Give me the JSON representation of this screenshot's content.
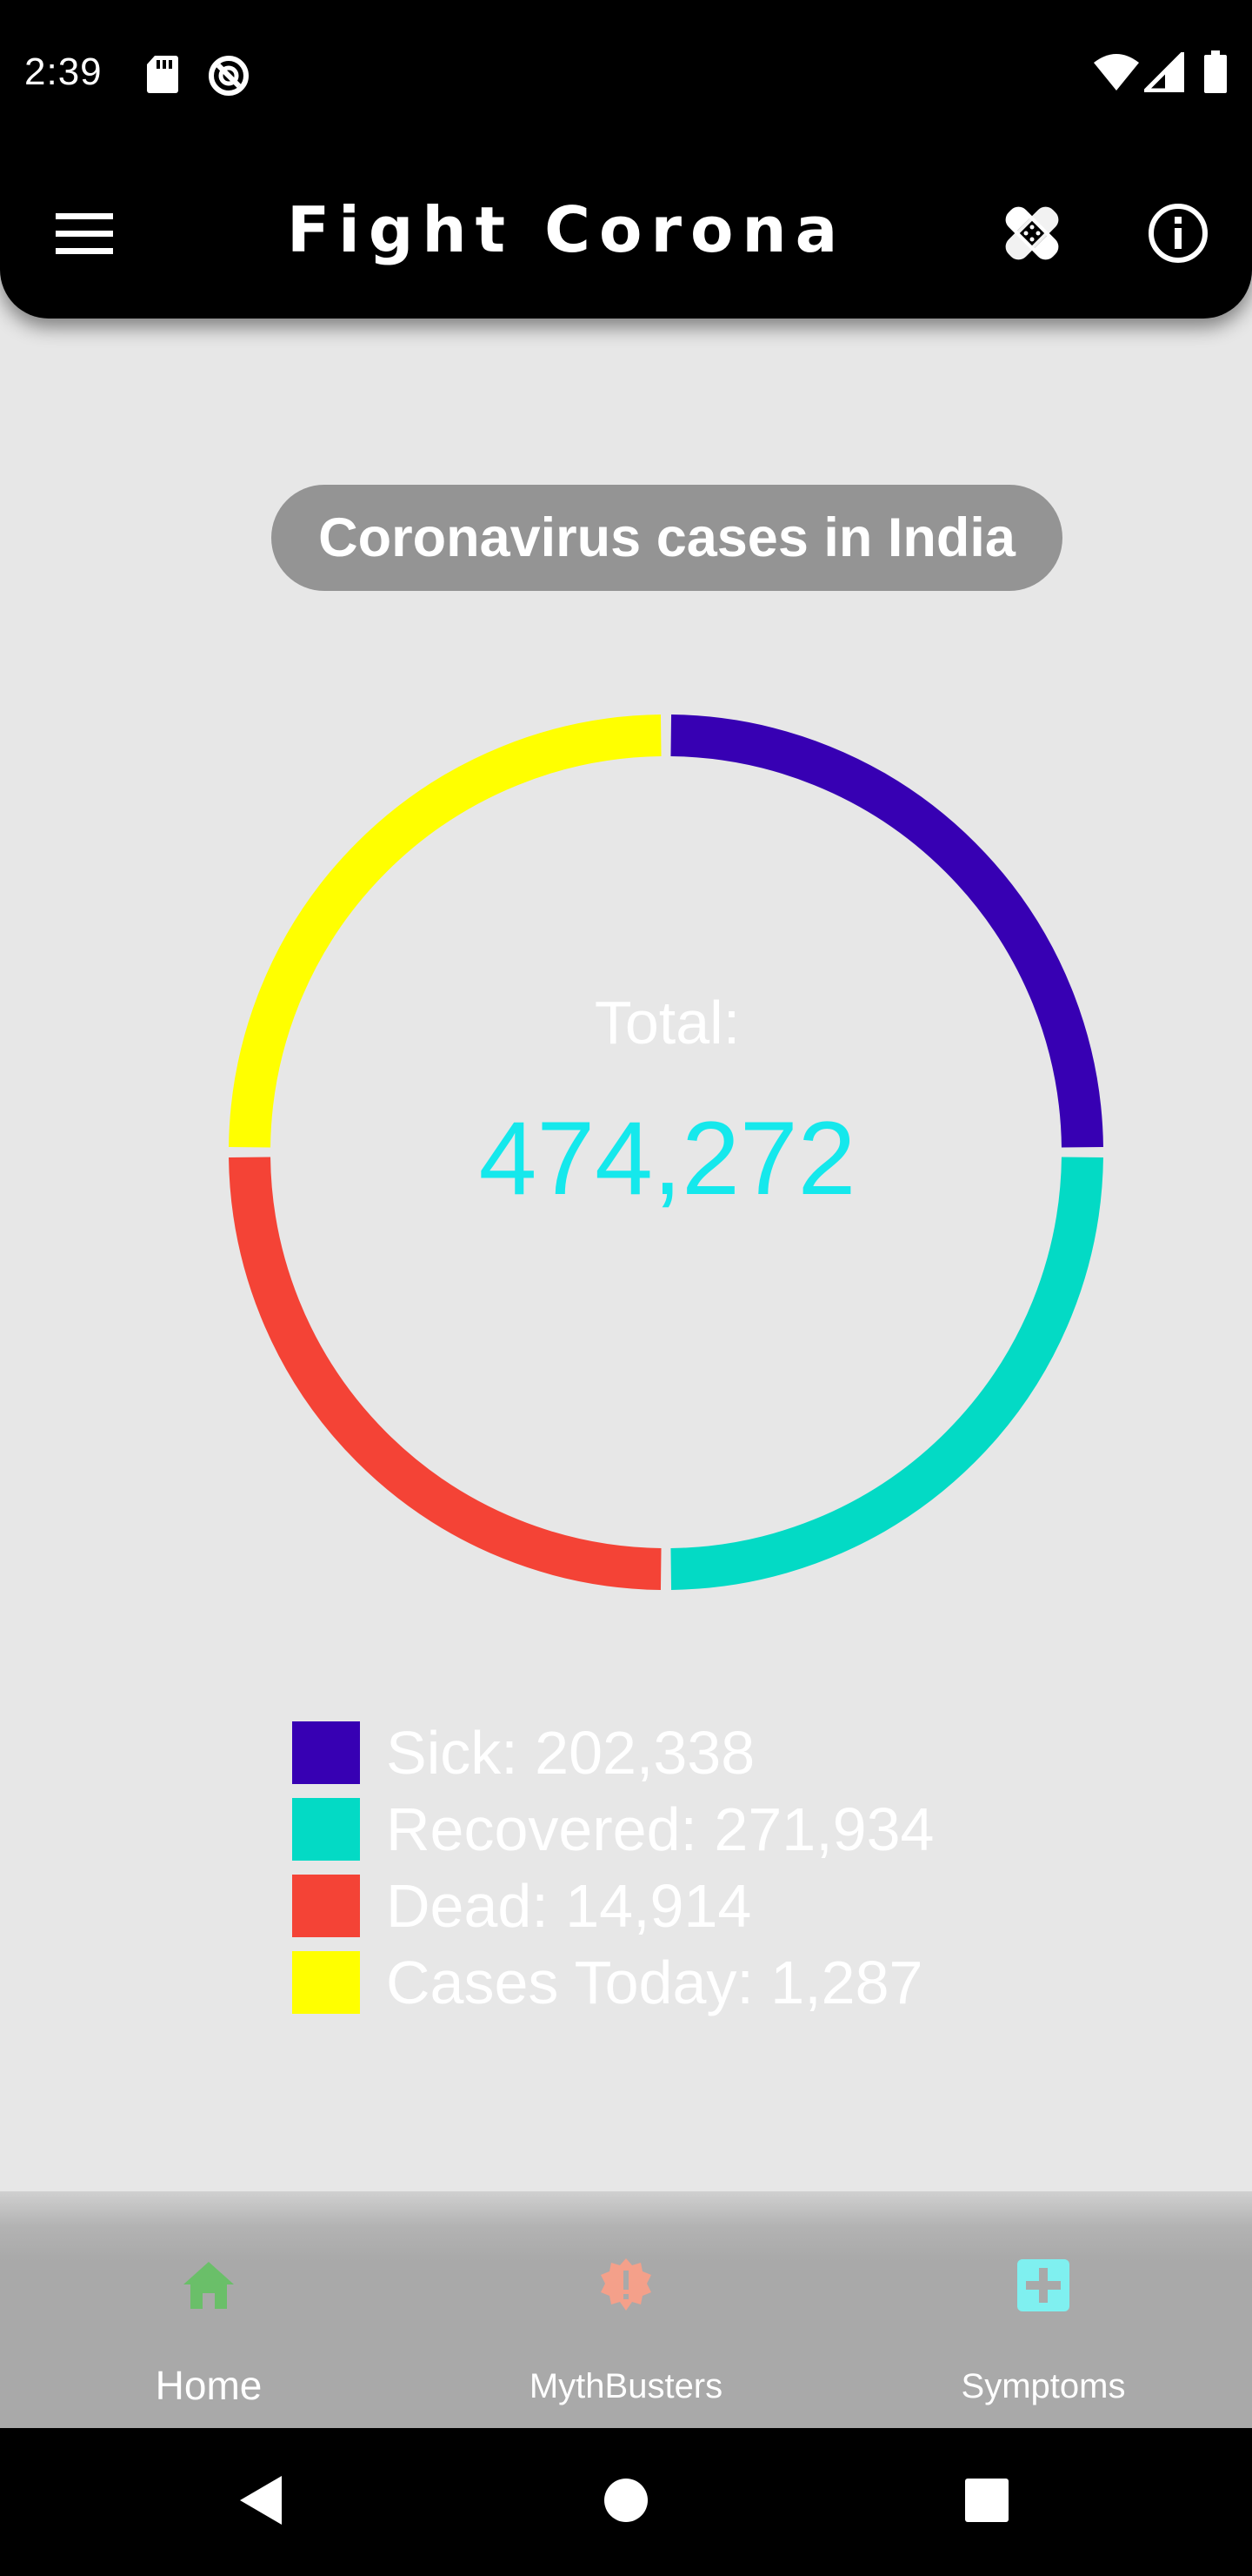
{
  "status_bar": {
    "time": "2:39",
    "icons": [
      "sd-card-icon",
      "do-not-disturb-icon",
      "wifi-icon",
      "signal-icon",
      "battery-icon"
    ]
  },
  "app_bar": {
    "title": "Fight Corona",
    "menu_icon": "hamburger-menu-icon",
    "action_icons": [
      "bandage-icon",
      "info-icon"
    ]
  },
  "main": {
    "heading": "Coronavirus cases in India",
    "total_label": "Total:",
    "total_value": "474,272"
  },
  "chart_data": {
    "type": "pie",
    "style": "donut",
    "center_label": "Total:",
    "center_value": "474,272",
    "slices": [
      {
        "name": "Sick",
        "value": 202338,
        "color": "#3700b3"
      },
      {
        "name": "Recovered",
        "value": 271934,
        "color": "#03dac5"
      },
      {
        "name": "Dead",
        "value": 14914,
        "color": "#f44336"
      },
      {
        "name": "Cases Today",
        "value": 1287,
        "color": "#ffff00"
      }
    ],
    "legend": [
      {
        "text": "Sick: 202,338",
        "color": "#3700b3"
      },
      {
        "text": "Recovered: 271,934",
        "color": "#03dac5"
      },
      {
        "text": "Dead: 14,914",
        "color": "#f44336"
      },
      {
        "text": "Cases Today: 1,287",
        "color": "#ffff00"
      }
    ],
    "legend_placement": "bottom"
  },
  "bottom_nav": {
    "items": [
      {
        "label": "Home",
        "icon": "home-icon",
        "color": "#6abf69",
        "selected": true
      },
      {
        "label": "MythBusters",
        "icon": "alert-badge-icon",
        "color": "#f4a08a",
        "selected": false
      },
      {
        "label": "Symptoms",
        "icon": "medical-cross-icon",
        "color": "#7ff0f0",
        "selected": false
      }
    ]
  },
  "system_nav": {
    "buttons": [
      "back-icon",
      "home-circle-icon",
      "recents-icon"
    ]
  },
  "colors": {
    "background": "#e7e7e7",
    "app_bar": "#000000",
    "pill": "#949494",
    "total_value": "#15e8ec",
    "bottom_nav": "#a9a9a9"
  }
}
